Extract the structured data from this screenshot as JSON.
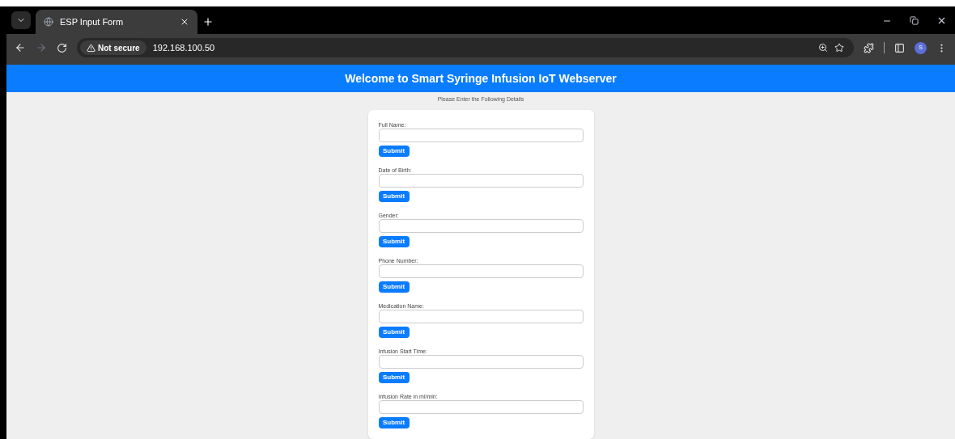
{
  "browser": {
    "tab": {
      "title": "ESP Input Form",
      "selected": true
    },
    "security": "Not secure",
    "url": "192.168.100.50",
    "profile_initial": "S"
  },
  "page": {
    "header": "Welcome to Smart Syringe Infusion IoT Webserver",
    "instruction": "Please Enter the Following Details",
    "fields": [
      {
        "label": "Full Name:",
        "button": "Submit"
      },
      {
        "label": "Date of Birth:",
        "button": "Submit"
      },
      {
        "label": "Gender:",
        "button": "Submit"
      },
      {
        "label": "Phone Number:",
        "button": "Submit"
      },
      {
        "label": "Medication Name:",
        "button": "Submit"
      },
      {
        "label": "Infusion Start Time:",
        "button": "Submit"
      },
      {
        "label": "Infusion Rate in ml/min:",
        "button": "Submit"
      }
    ]
  }
}
